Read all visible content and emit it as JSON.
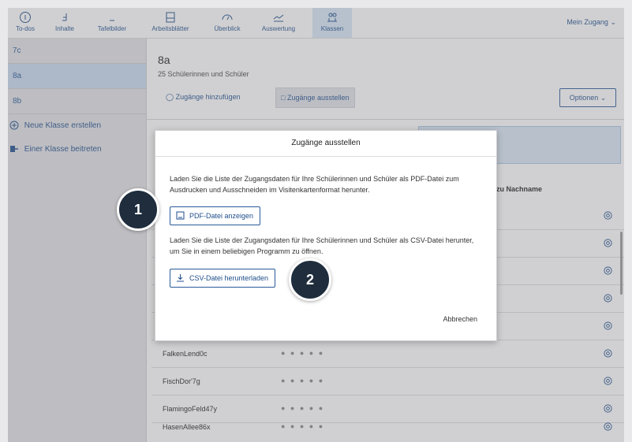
{
  "nav": {
    "items": [
      {
        "label": "To-dos",
        "icon": "info-circle-icon"
      },
      {
        "label": "Inhalte",
        "icon": "content-icon"
      },
      {
        "label": "Tafelbilder",
        "icon": "board-icon"
      },
      {
        "label": "Arbeitsblätter",
        "icon": "worksheet-icon"
      },
      {
        "label": "Überblick",
        "icon": "gauge-icon"
      },
      {
        "label": "Auswertung",
        "icon": "chart-line-icon"
      },
      {
        "label": "Klassen",
        "icon": "group-icon"
      }
    ],
    "active": "Klassen",
    "account": "Mein Zugang"
  },
  "sidebar": {
    "classes": [
      {
        "label": "7c"
      },
      {
        "label": "8a"
      },
      {
        "label": "8b"
      }
    ],
    "selected": "8a",
    "actions": [
      {
        "label": "Neue Klasse erstellen",
        "icon": "plus-circle-icon"
      },
      {
        "label": "Einer Klasse beitreten",
        "icon": "join-icon"
      }
    ]
  },
  "main": {
    "title": "8a",
    "subtitle": "25 Schülerinnen und Schüler",
    "add_access_label": "Zugänge hinzufügen",
    "issue_access_label": "Zugänge ausstellen",
    "options_label": "Optionen",
    "column_header": "lfe zu Nachname",
    "rows": [
      {
        "name": "",
        "password": ""
      },
      {
        "name": "",
        "password": ""
      },
      {
        "name": "",
        "password": ""
      },
      {
        "name": "",
        "password": ""
      },
      {
        "name": "",
        "password": ""
      },
      {
        "name": "FalkenLend0c",
        "password": "● ● ● ● ●"
      },
      {
        "name": "FischDor'7g",
        "password": "● ● ● ● ●"
      },
      {
        "name": "FlamingoFeld47y",
        "password": "● ● ● ● ●"
      },
      {
        "name": "HasenAllee86x",
        "password": "● ● ● ● ●"
      }
    ]
  },
  "modal": {
    "title": "Zugänge ausstellen",
    "pdf_text": "Laden Sie die Liste der Zugangsdaten für Ihre Schülerinnen und Schüler als PDF-Datei zum Ausdrucken und Ausschneiden im Visitenkartenformat herunter.",
    "pdf_button": "PDF-Datei anzeigen",
    "csv_text": "Laden Sie die Liste der Zugangsdaten für Ihre Schülerinnen und Schüler als CSV-Datei herunter, um Sie in einem beliebigen Programm zu öffnen.",
    "csv_button": "CSV-Datei herunterladen",
    "cancel_label": "Abbrechen"
  },
  "steps": {
    "one": "1",
    "two": "2"
  },
  "colors": {
    "accent": "#1f4e8c",
    "active_tab": "#d9e8f7",
    "badge": "#1f2d3d"
  }
}
